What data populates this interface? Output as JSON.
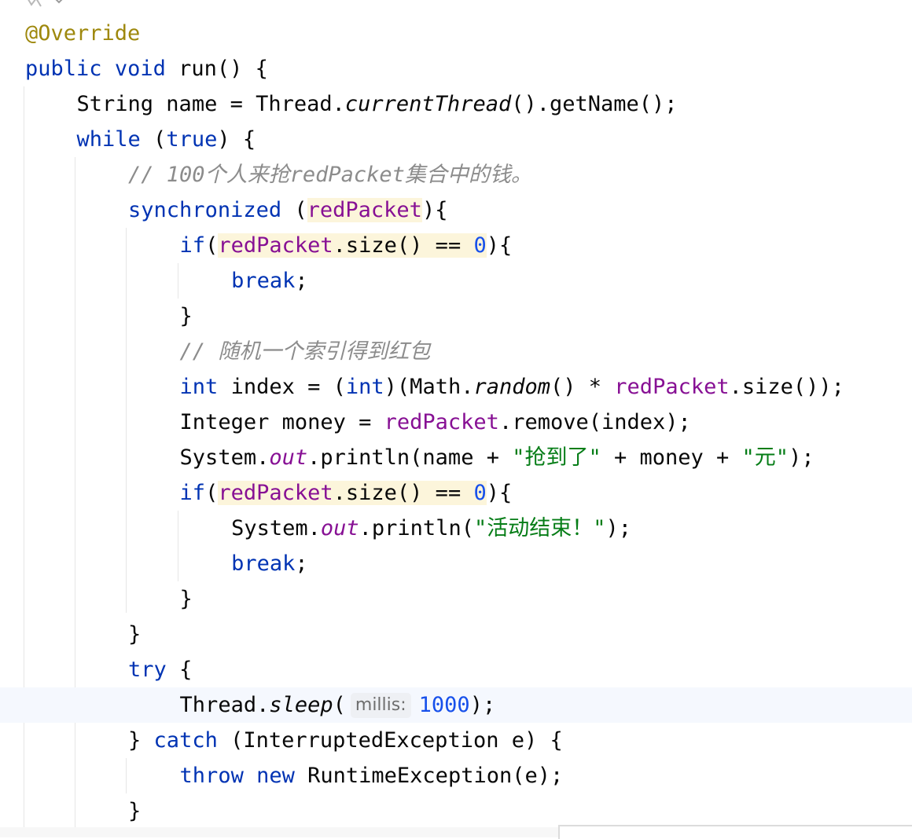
{
  "editor": {
    "current_line": 19,
    "lines": [
      [
        {
          "t": "@Override",
          "c": "anno"
        }
      ],
      [
        {
          "t": "public",
          "c": "kw"
        },
        {
          "t": " "
        },
        {
          "t": "void",
          "c": "kw"
        },
        {
          "t": " run() {"
        }
      ],
      [
        {
          "t": "String name = Thread."
        },
        {
          "t": "currentThread",
          "c": "it"
        },
        {
          "t": "().getName();"
        }
      ],
      [
        {
          "t": "while",
          "c": "kw"
        },
        {
          "t": " ("
        },
        {
          "t": "true",
          "c": "kw"
        },
        {
          "t": ") {"
        }
      ],
      [
        {
          "t": "// 100个人来抢redPacket集合中的钱。",
          "c": "cmt"
        }
      ],
      [
        {
          "t": "synchronized",
          "c": "kw"
        },
        {
          "t": " ("
        },
        {
          "t": "redPacket",
          "c": "field hl"
        },
        {
          "t": "){"
        }
      ],
      [
        {
          "t": "if",
          "c": "kw"
        },
        {
          "t": "("
        },
        {
          "t": "redPacket",
          "c": "field hl"
        },
        {
          "t": ".size() == ",
          "c": "hl"
        },
        {
          "t": "0",
          "c": "num hl"
        },
        {
          "t": "){"
        }
      ],
      [
        {
          "t": "break",
          "c": "kw"
        },
        {
          "t": ";"
        }
      ],
      [
        {
          "t": "}"
        }
      ],
      [
        {
          "t": "// 随机一个索引得到红包",
          "c": "cmt"
        }
      ],
      [
        {
          "t": "int",
          "c": "kw"
        },
        {
          "t": " index = ("
        },
        {
          "t": "int",
          "c": "kw"
        },
        {
          "t": ")(Math."
        },
        {
          "t": "random",
          "c": "it"
        },
        {
          "t": "() * "
        },
        {
          "t": "redPacket",
          "c": "field"
        },
        {
          "t": ".size());"
        }
      ],
      [
        {
          "t": "Integer money = "
        },
        {
          "t": "redPacket",
          "c": "field"
        },
        {
          "t": ".remove(index);"
        }
      ],
      [
        {
          "t": "System."
        },
        {
          "t": "out",
          "c": "field it"
        },
        {
          "t": ".println(name + "
        },
        {
          "t": "\"抢到了\"",
          "c": "str"
        },
        {
          "t": " + money + "
        },
        {
          "t": "\"元\"",
          "c": "str"
        },
        {
          "t": ");"
        }
      ],
      [
        {
          "t": "if",
          "c": "kw"
        },
        {
          "t": "("
        },
        {
          "t": "redPacket",
          "c": "field hl"
        },
        {
          "t": ".size() == ",
          "c": "hl"
        },
        {
          "t": "0",
          "c": "num hl"
        },
        {
          "t": "){"
        }
      ],
      [
        {
          "t": "System."
        },
        {
          "t": "out",
          "c": "field it"
        },
        {
          "t": ".println("
        },
        {
          "t": "\"活动结束！\"",
          "c": "str"
        },
        {
          "t": ");"
        }
      ],
      [
        {
          "t": "break",
          "c": "kw"
        },
        {
          "t": ";"
        }
      ],
      [
        {
          "t": "}"
        }
      ],
      [
        {
          "t": "}"
        }
      ],
      [
        {
          "t": "try",
          "c": "kw"
        },
        {
          "t": " {"
        }
      ],
      [
        {
          "t": "Thread."
        },
        {
          "t": "sleep",
          "c": "it"
        },
        {
          "t": "("
        },
        {
          "hint": "millis:"
        },
        {
          "t": "1000",
          "c": "num"
        },
        {
          "t": ");"
        }
      ],
      [
        {
          "t": "}"
        },
        {
          "t": " catch",
          "c": "kw"
        },
        {
          "t": " (InterruptedException e) {"
        }
      ],
      [
        {
          "t": "throw",
          "c": "kw"
        },
        {
          "t": " "
        },
        {
          "t": "new",
          "c": "kw"
        },
        {
          "t": " RuntimeException(e);"
        }
      ],
      [
        {
          "t": "}"
        }
      ]
    ]
  }
}
